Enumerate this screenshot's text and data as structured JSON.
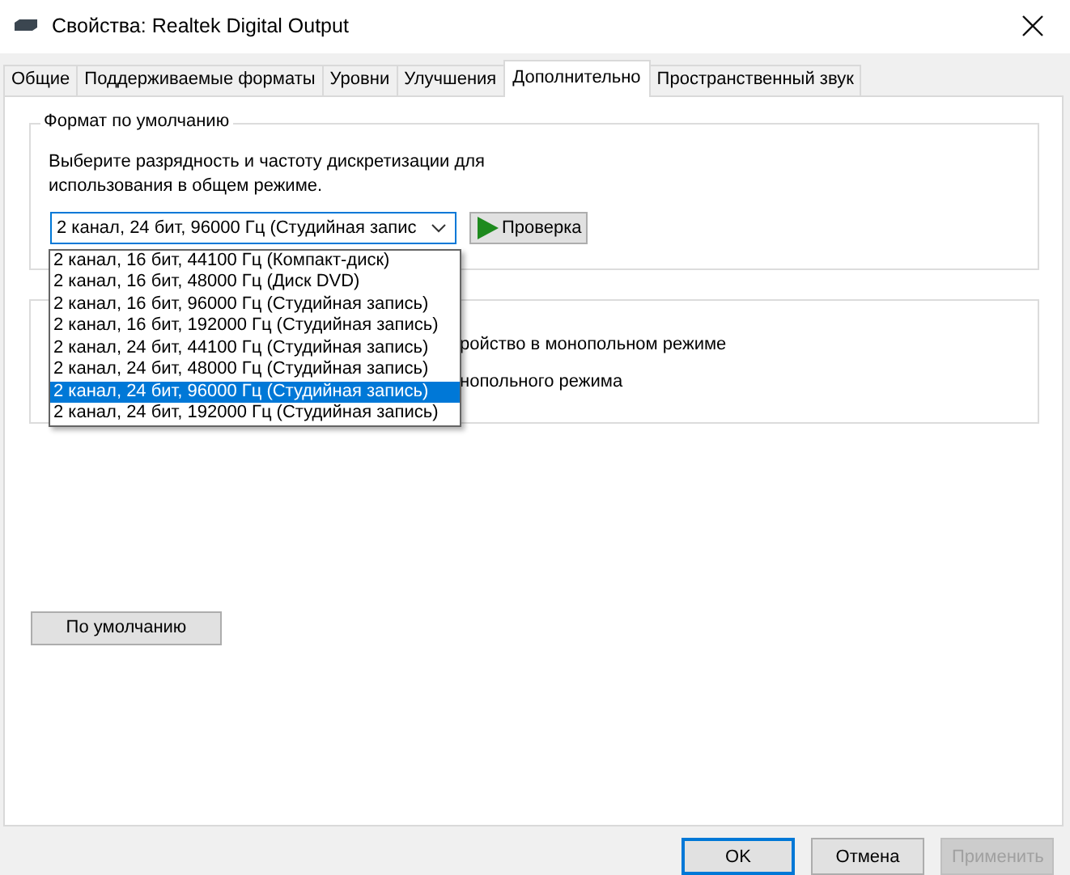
{
  "window": {
    "title": "Свойства: Realtek Digital Output"
  },
  "tabs": [
    {
      "label": "Общие",
      "selected": false
    },
    {
      "label": "Поддерживаемые форматы",
      "selected": false
    },
    {
      "label": "Уровни",
      "selected": false
    },
    {
      "label": "Улучшения",
      "selected": false
    },
    {
      "label": "Дополнительно",
      "selected": true
    },
    {
      "label": "Пространственный звук",
      "selected": false
    }
  ],
  "default_format": {
    "title": "Формат по умолчанию",
    "description": "Выберите разрядность и частоту дискретизации для использования в общем режиме.",
    "value": "2 канал, 24 бит, 96000 Гц (Студийная запис",
    "test_button": "Проверка",
    "options": [
      {
        "label": "2 канал, 16 бит, 44100 Гц (Компакт-диск)",
        "selected": false
      },
      {
        "label": "2 канал, 16 бит, 48000 Гц (Диск DVD)",
        "selected": false
      },
      {
        "label": "2 канал, 16 бит, 96000 Гц (Студийная запись)",
        "selected": false
      },
      {
        "label": "2 канал, 16 бит, 192000 Гц (Студийная запись)",
        "selected": false
      },
      {
        "label": "2 канал, 24 бит, 44100 Гц (Студийная запись)",
        "selected": false
      },
      {
        "label": "2 канал, 24 бит, 48000 Гц (Студийная запись)",
        "selected": false
      },
      {
        "label": "2 канал, 24 бит, 96000 Гц (Студийная запись)",
        "selected": true
      },
      {
        "label": "2 канал, 24 бит, 192000 Гц (Студийная запись)",
        "selected": false
      }
    ]
  },
  "exclusive_group": {
    "lines": [
      "ройство в монопольном режиме",
      "нопольного режима"
    ]
  },
  "restore_button": "По умолчанию",
  "buttons": [
    {
      "label": "OK",
      "kind": "default"
    },
    {
      "label": "Отмена",
      "kind": "normal"
    },
    {
      "label": "Применить",
      "kind": "disabled"
    }
  ]
}
